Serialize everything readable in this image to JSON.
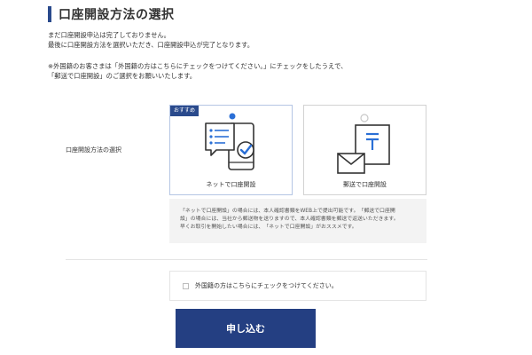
{
  "page": {
    "title": "口座開設方法の選択",
    "notice_lines": [
      "まだ口座開設申込は完了しておりません。",
      "最後に口座開設方法を選択いただき、口座開設申込が完了となります。",
      "※外国籍のお客さまは「外国籍の方はこちらにチェックをつけてください。」にチェックをしたうえで、",
      "「郵送で口座開設」のご選択をお願いいたします。"
    ]
  },
  "method": {
    "label": "口座開設方法の選択",
    "options": [
      {
        "badge": "おすすめ",
        "label": "ネットで口座開設",
        "icon": "smartphone-check-icon",
        "selected": true
      },
      {
        "label": "郵送で口座開設",
        "icon": "mail-post-icon",
        "selected": false
      }
    ],
    "description_lines": [
      "「ネットで口座開設」の場合には、本人確認書類をWEB上で提出可能です。「郵送で口座開",
      "設」の場合には、当社から郵送物を送りますので、本人確認書類を郵送で返送いただきます。",
      "早くお取引を開始したい場合には、「ネットで口座開設」がおススメです。"
    ]
  },
  "foreign": {
    "label": "外国籍の方はこちらにチェックをつけてください。",
    "checked": false
  },
  "submit": {
    "label": "申し込む"
  },
  "colors": {
    "accent": "#2a4a8c",
    "button": "#243f82"
  }
}
